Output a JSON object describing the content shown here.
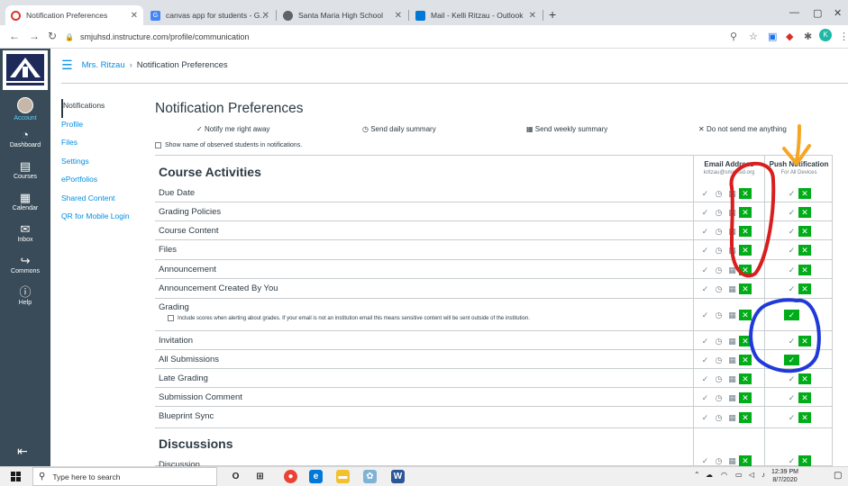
{
  "browser": {
    "tabs": [
      {
        "title": "Notification Preferences",
        "active": true,
        "icon_color": "#e0342c"
      },
      {
        "title": "canvas app for students - Googl",
        "active": false,
        "icon_color": "#4285f4"
      },
      {
        "title": "Santa Maria High School",
        "active": false,
        "icon_color": "#5f6368"
      },
      {
        "title": "Mail - Kelli Ritzau - Outlook",
        "active": false,
        "icon_color": "#0078d4"
      }
    ],
    "url": "smjuhsd.instructure.com/profile/communication",
    "profile_initial": "K"
  },
  "global_nav": {
    "items": [
      {
        "label": "Account",
        "icon": "avatar"
      },
      {
        "label": "Dashboard",
        "icon": "dashboard-icon"
      },
      {
        "label": "Courses",
        "icon": "courses-icon"
      },
      {
        "label": "Calendar",
        "icon": "calendar-icon"
      },
      {
        "label": "Inbox",
        "icon": "inbox-icon"
      },
      {
        "label": "Commons",
        "icon": "commons-icon"
      },
      {
        "label": "Help",
        "icon": "help-icon"
      }
    ],
    "colors": {
      "nav_bg": "#394b58",
      "brand": "#008ee2",
      "accent": "#00ac18"
    }
  },
  "breadcrumb": {
    "user": "Mrs. Ritzau",
    "page": "Notification Preferences"
  },
  "section_nav": [
    "Notifications",
    "Profile",
    "Files",
    "Settings",
    "ePortfolios",
    "Shared Content",
    "QR for Mobile Login"
  ],
  "page_title": "Notification Preferences",
  "legend": {
    "immediate": "Notify me right away",
    "daily": "Send daily summary",
    "weekly": "Send weekly summary",
    "never": "Do not send me anything"
  },
  "show_observed": "Show name of observed students in notifications.",
  "columns": {
    "email": {
      "title": "Email Address",
      "sub": "kritzau@smjuhsd.org"
    },
    "push": {
      "title": "Push Notification",
      "sub": "For All Devices"
    }
  },
  "categories": {
    "course": "Course Activities",
    "discussions": "Discussions"
  },
  "rows": [
    {
      "label": "Due Date",
      "email": "never",
      "push": "never"
    },
    {
      "label": "Grading Policies",
      "email": "never",
      "push": "never"
    },
    {
      "label": "Course Content",
      "email": "never",
      "push": "never"
    },
    {
      "label": "Files",
      "email": "never",
      "push": "never"
    },
    {
      "label": "Announcement",
      "email": "never",
      "push": "never"
    },
    {
      "label": "Announcement Created By You",
      "email": "never",
      "push": "never"
    },
    {
      "label": "Grading",
      "email": "never",
      "push": "immediate",
      "sub": "Include scores when alerting about grades. If your email is not an institution email this means sensitive content will be sent outside of the institution."
    },
    {
      "label": "Invitation",
      "email": "never",
      "push": "never"
    },
    {
      "label": "All Submissions",
      "email": "never",
      "push": "immediate"
    },
    {
      "label": "Late Grading",
      "email": "never",
      "push": "never"
    },
    {
      "label": "Submission Comment",
      "email": "never",
      "push": "never"
    },
    {
      "label": "Blueprint Sync",
      "email": "never",
      "push": "never"
    },
    {
      "label": "Discussion",
      "email": "never",
      "push": "never"
    }
  ],
  "taskbar": {
    "search_placeholder": "Type here to search",
    "time": "12:39 PM",
    "date": "8/7/2020"
  }
}
